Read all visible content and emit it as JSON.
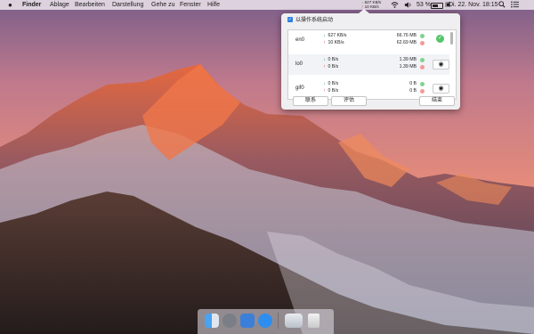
{
  "menubar": {
    "app": "Finder",
    "menus": [
      "Ablage",
      "Bearbeiten",
      "Darstellung",
      "Gehe zu",
      "Fenster",
      "Hilfe"
    ],
    "net_up": "627 KB/s",
    "net_down": "10 KB/s",
    "volume_icon": "speaker-icon",
    "battery_percent": "53 %",
    "datetime": "Di. 22. Nov.  18:15"
  },
  "popup": {
    "autostart_label": "以操作系统启动",
    "interfaces": [
      {
        "name": "en0",
        "down_rate": "627 KB/s",
        "up_rate": "10 KB/s",
        "down_total": "66.76 MB",
        "up_total": "62.69 MB",
        "action_icon": "check-icon"
      },
      {
        "name": "lo0",
        "down_rate": "0 B/s",
        "up_rate": "0 B/s",
        "down_total": "1.39 MB",
        "up_total": "1.39 MB",
        "action_icon": "eye-icon"
      },
      {
        "name": "gif0",
        "down_rate": "0 B/s",
        "up_rate": "0 B/s",
        "down_total": "0 B",
        "up_total": "0 B",
        "action_icon": "eye-icon"
      }
    ],
    "buttons": {
      "contact": "联系",
      "rate": "评估",
      "quit": "结束"
    }
  },
  "colors": {
    "accent": "#2f7de1",
    "download": "#27a844",
    "upload": "#d62b2b"
  }
}
